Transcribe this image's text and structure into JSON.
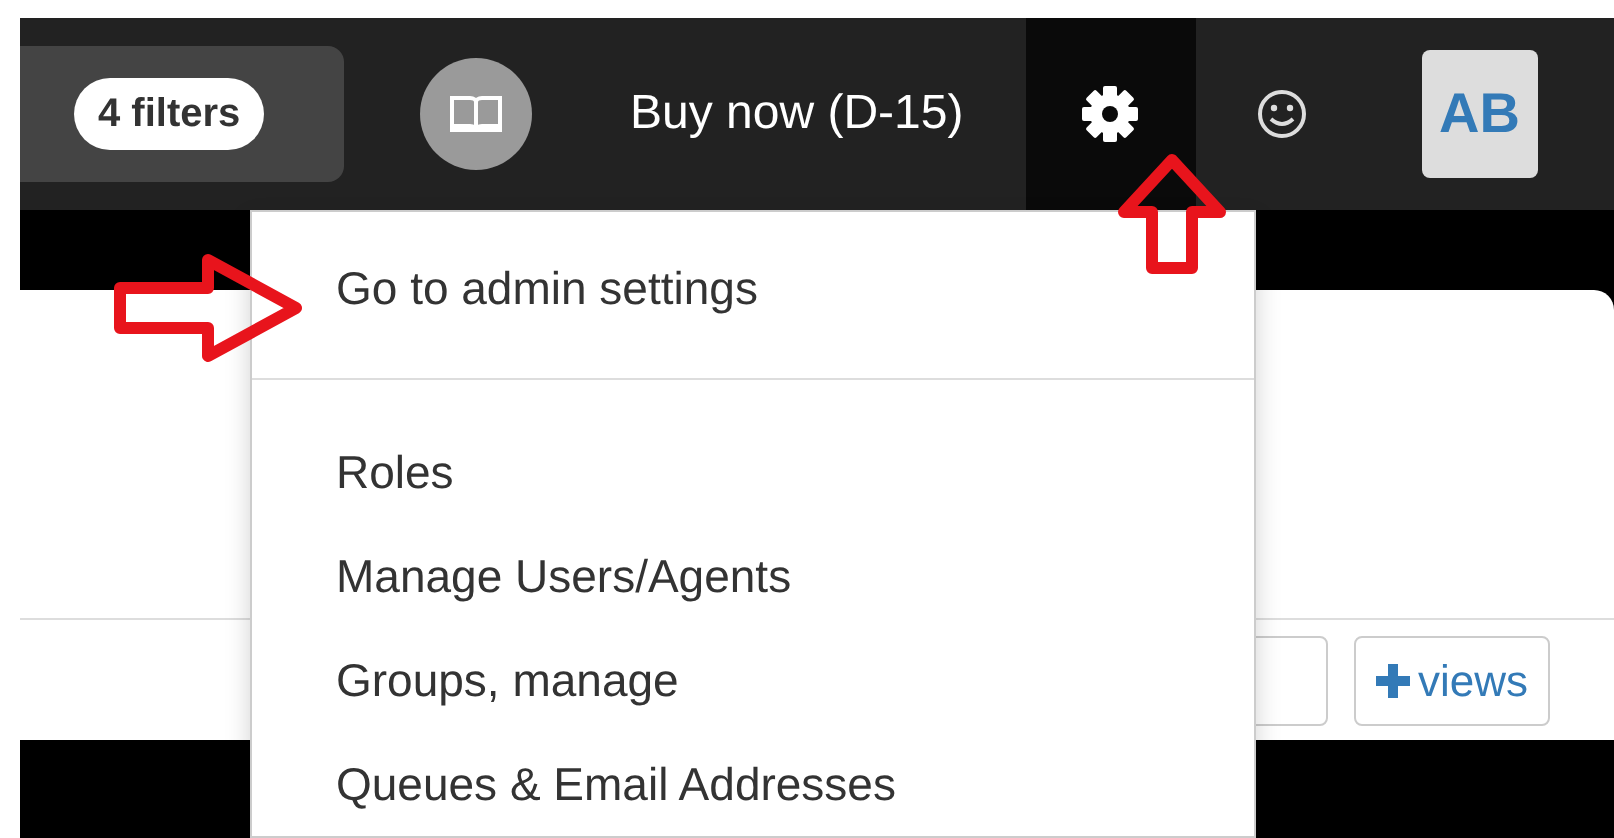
{
  "navbar": {
    "filter_badge": "4 filters",
    "buy_button": "Buy now (D-15)",
    "settings_open": true,
    "avatar": "AB"
  },
  "dropdown": {
    "items": [
      {
        "kind": "link",
        "label": "Go to admin settings"
      },
      {
        "kind": "divider"
      },
      {
        "kind": "link",
        "label": "Roles"
      },
      {
        "kind": "link",
        "label": "Manage Users/Agents"
      },
      {
        "kind": "link",
        "label": "Groups, manage"
      },
      {
        "kind": "link",
        "label": "Queues & Email Addresses"
      }
    ]
  },
  "panel": {
    "buttons": [
      {
        "kind": "plain"
      },
      {
        "kind": "add",
        "label": "views"
      }
    ]
  },
  "annotations": [
    {
      "kind": "right-arrow"
    },
    {
      "kind": "up-arrow"
    }
  ]
}
